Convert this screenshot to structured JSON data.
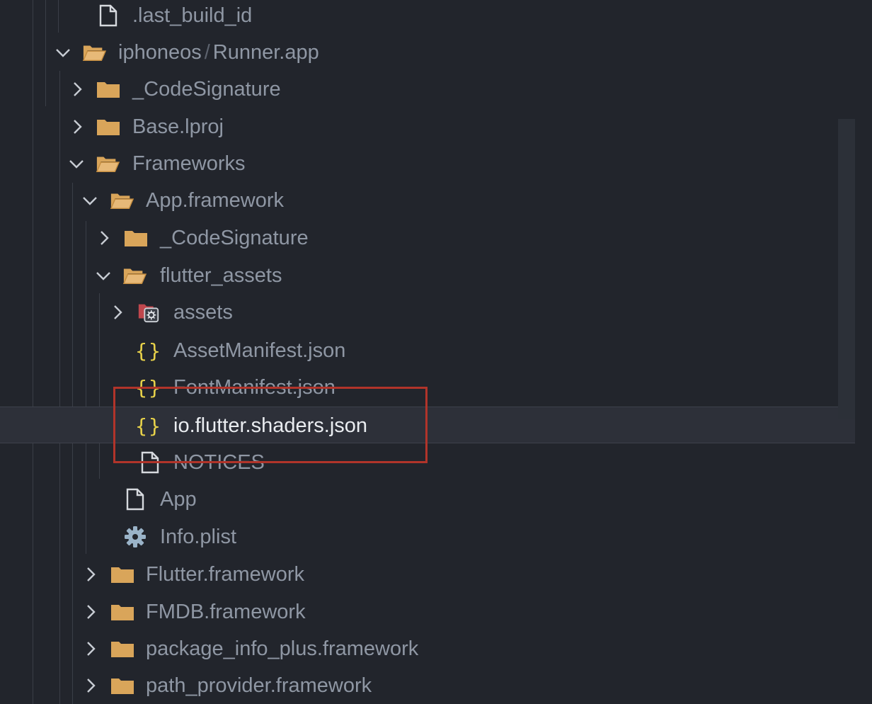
{
  "tree": {
    "rows": [
      {
        "label": ".last_build_id"
      },
      {
        "label": "iphoneos",
        "label_suffix": "Runner.app",
        "separator": "/"
      },
      {
        "label": "_CodeSignature"
      },
      {
        "label": "Base.lproj"
      },
      {
        "label": "Frameworks"
      },
      {
        "label": "App.framework"
      },
      {
        "label": "_CodeSignature"
      },
      {
        "label": "flutter_assets"
      },
      {
        "label": "assets"
      },
      {
        "label": "AssetManifest.json",
        "icon_text": "{}"
      },
      {
        "label": "FontManifest.json",
        "icon_text": "{}"
      },
      {
        "label": "io.flutter.shaders.json",
        "icon_text": "{}",
        "selected": true
      },
      {
        "label": "NOTICES"
      },
      {
        "label": "App"
      },
      {
        "label": "Info.plist"
      },
      {
        "label": "Flutter.framework"
      },
      {
        "label": "FMDB.framework"
      },
      {
        "label": "package_info_plus.framework"
      },
      {
        "label": "path_provider.framework"
      }
    ]
  },
  "colors": {
    "background": "#22252c",
    "folder": "#d9a55a",
    "json_braces": "#e8d24a",
    "highlight": "#b1342a",
    "text": "#8f97a4",
    "selected_text": "#e9ecf0"
  },
  "icons": [
    "file-icon",
    "folder-open-icon",
    "folder-icon",
    "assets-folder-icon",
    "json-icon",
    "gear-icon",
    "chevron-right-icon",
    "chevron-down-icon"
  ]
}
